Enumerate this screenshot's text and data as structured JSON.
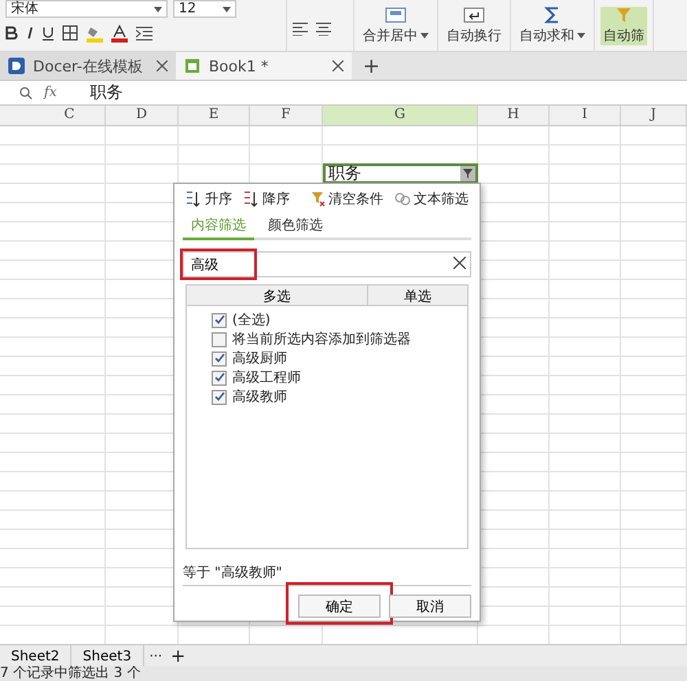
{
  "ribbon": {
    "font_name": "宋体",
    "font_size": "12",
    "buttons": [
      {
        "label": "合并居中",
        "kind": "merge",
        "dropdown": true
      },
      {
        "label": "自动换行",
        "kind": "wrap",
        "dropdown": false
      },
      {
        "label": "自动求和",
        "kind": "sum",
        "dropdown": true
      },
      {
        "label": "自动筛",
        "kind": "filter",
        "dropdown": false
      }
    ]
  },
  "doc_tabs": [
    {
      "label": "Docer-在线模板",
      "kind": "docer",
      "selected": false
    },
    {
      "label": "Book1 *",
      "kind": "book",
      "selected": true
    }
  ],
  "new_tab": "+",
  "formula_bar": {
    "fx": "fx",
    "value": "职务"
  },
  "columns": [
    {
      "label": "C",
      "selected": false
    },
    {
      "label": "D",
      "selected": false
    },
    {
      "label": "E",
      "selected": false
    },
    {
      "label": "F",
      "selected": false
    },
    {
      "label": "G",
      "selected": true
    },
    {
      "label": "H",
      "selected": false
    },
    {
      "label": "I",
      "selected": false
    },
    {
      "label": "J",
      "selected": false
    }
  ],
  "active_cell": {
    "value": "职务"
  },
  "filter_panel": {
    "sort": [
      {
        "label": "升序",
        "kind": "asc"
      },
      {
        "label": "降序",
        "kind": "desc"
      }
    ],
    "actions": [
      {
        "label": "清空条件",
        "kind": "clear"
      },
      {
        "label": "文本筛选",
        "kind": "text"
      }
    ],
    "tabs": [
      {
        "label": "内容筛选",
        "selected": true
      },
      {
        "label": "颜色筛选",
        "selected": false
      }
    ],
    "search": {
      "value": "高级",
      "highlighted": true
    },
    "list_modes": [
      "多选",
      "单选"
    ],
    "items": [
      {
        "label": "(全选)",
        "checked": true
      },
      {
        "label": "将当前所选内容添加到筛选器",
        "checked": false
      },
      {
        "label": "高级厨师",
        "checked": true
      },
      {
        "label": "高级工程师",
        "checked": true
      },
      {
        "label": "高级教师",
        "checked": true
      }
    ],
    "summary": "等于 \"高级教师\"",
    "buttons": [
      {
        "label": "确定",
        "highlighted": true
      },
      {
        "label": "取消",
        "highlighted": false
      }
    ]
  },
  "sheet_tabs": [
    "Sheet2",
    "Sheet3"
  ],
  "sheet_more": "···",
  "sheet_add": "+",
  "status_bar": "7 个记录中筛选出 3 个"
}
